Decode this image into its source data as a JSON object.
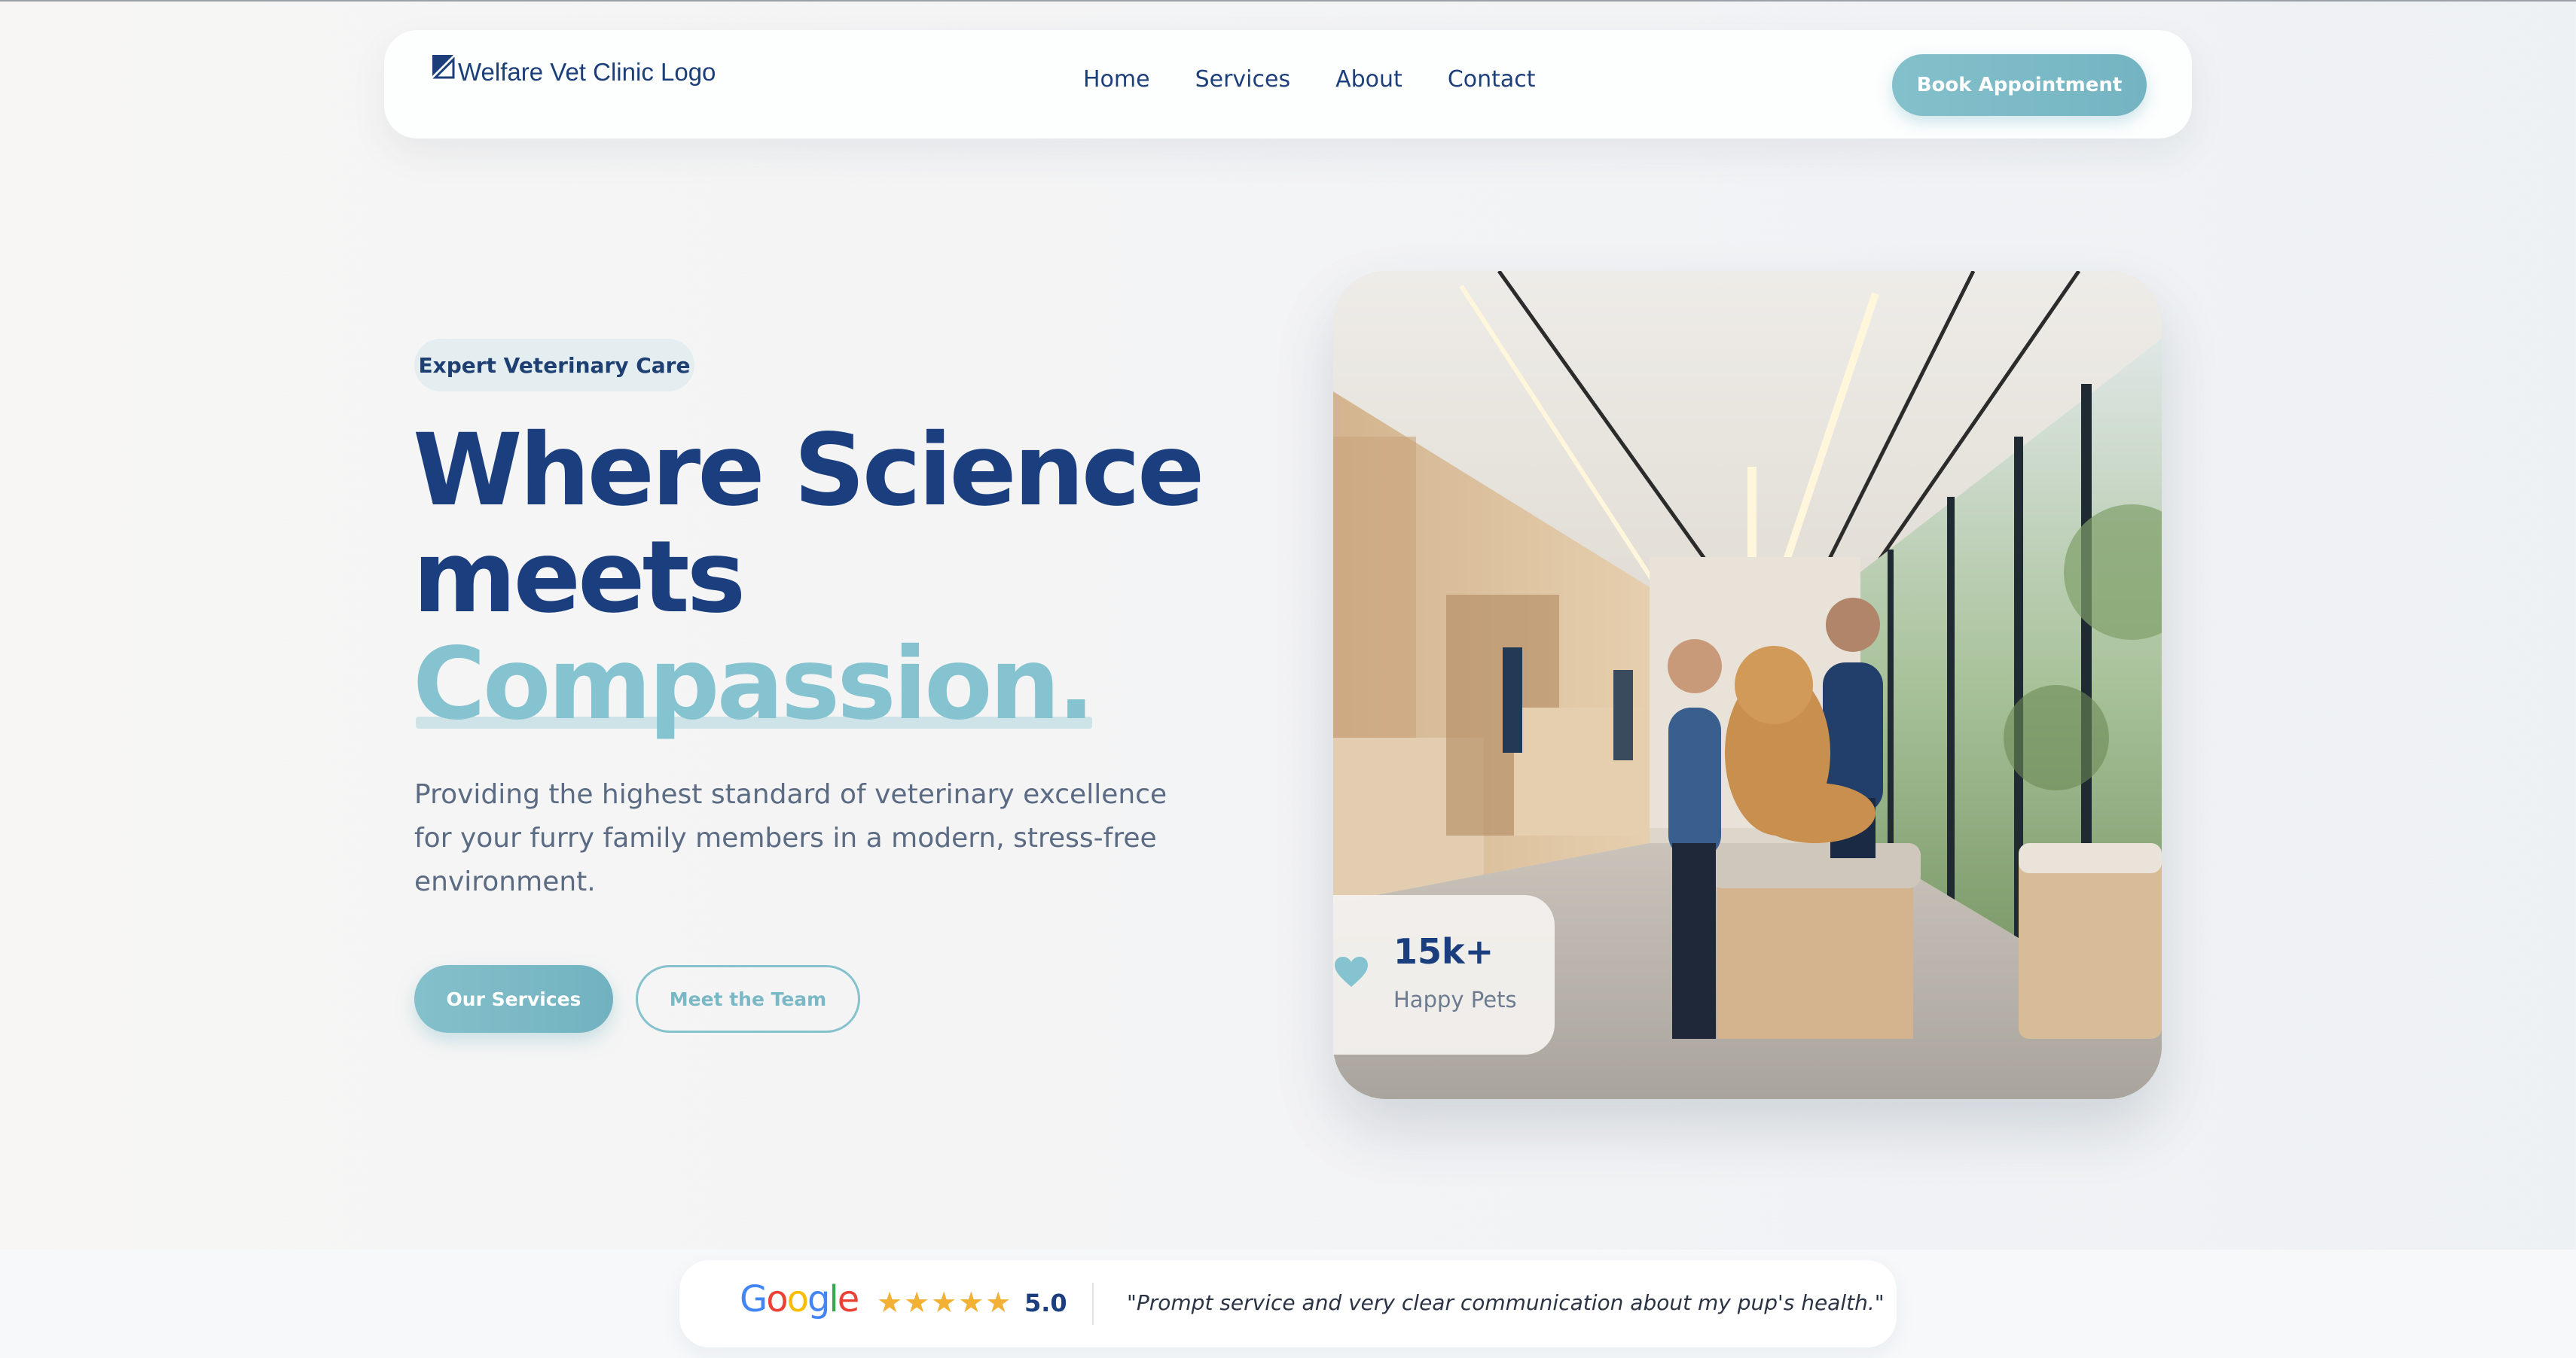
{
  "nav": {
    "logo_text": "Welfare Vet Clinic Logo",
    "links": [
      "Home",
      "Services",
      "About",
      "Contact"
    ],
    "cta_label": "Book Appointment"
  },
  "hero": {
    "badge": "Expert Veterinary Care",
    "headline_line1": "Where Science",
    "headline_line2": "meets",
    "headline_accent": "Compassion.",
    "subtext": "Providing the highest standard of veterinary excellence for your furry family members in a modern, stress-free environment.",
    "primary_button": "Our Services",
    "secondary_button": "Meet the Team"
  },
  "stat": {
    "value": "15k+",
    "label": "Happy Pets",
    "icon": "heart-icon"
  },
  "review": {
    "source": "Google",
    "stars": "★★★★★",
    "rating": "5.0",
    "quote": "\"Prompt service and very clear communication about my pup's health.\""
  },
  "colors": {
    "primary": "#1b3f7e",
    "accent": "#84c3cf",
    "star": "#f2b134"
  }
}
